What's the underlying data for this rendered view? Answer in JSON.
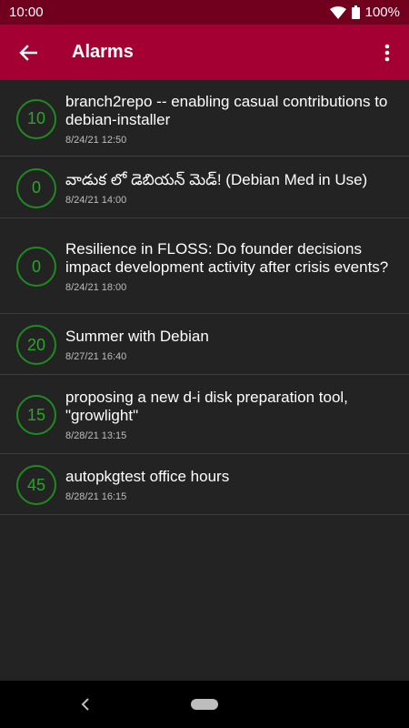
{
  "status_bar": {
    "time": "10:00",
    "battery": "100%"
  },
  "app_bar": {
    "title": "Alarms"
  },
  "alarms": [
    {
      "count": "10",
      "title": "branch2repo -- enabling casual contributions to debian-installer",
      "time": "8/24/21 12:50"
    },
    {
      "count": "0",
      "title": "వాడుక లో డెబియన్ మెడ్! (Debian Med in Use)",
      "time": "8/24/21 14:00"
    },
    {
      "count": "0",
      "title": "Resilience in FLOSS: Do founder decisions impact development activity after crisis events?",
      "time": "8/24/21 18:00"
    },
    {
      "count": "20",
      "title": "Summer with Debian",
      "time": "8/27/21 16:40"
    },
    {
      "count": "15",
      "title": "proposing a new d-i disk preparation tool, \"growlight\"",
      "time": "8/28/21 13:15"
    },
    {
      "count": "45",
      "title": "autopkgtest office hours",
      "time": "8/28/21 16:15"
    }
  ]
}
